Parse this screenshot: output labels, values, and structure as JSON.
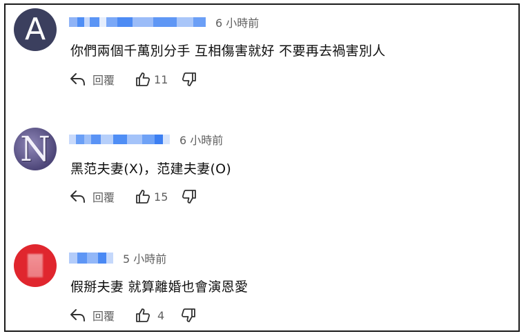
{
  "comments": [
    {
      "avatar_letter": "A",
      "time": "6 小時前",
      "text": "你們兩個千萬別分手 互相傷害就好 不要再去禍害別人",
      "reply_label": "回覆",
      "like_count": "11"
    },
    {
      "avatar_letter": "N",
      "time": "6 小時前",
      "text": "黑范夫妻(X)，范建夫妻(O)",
      "reply_label": "回覆",
      "like_count": "15"
    },
    {
      "avatar_letter": "",
      "time": "5 小時前",
      "text": "假掰夫妻 就算離婚也會演恩愛",
      "reply_label": "回覆",
      "like_count": "4"
    }
  ],
  "icons": {
    "reply": "reply-arrow-icon",
    "like": "thumbs-up-icon",
    "dislike": "thumbs-down-icon"
  },
  "colors": {
    "avatar_1": "#3b3f5e",
    "avatar_2": "#6a6199",
    "avatar_3": "#e0262e",
    "blurred_username": "#3b82f6",
    "meta_text": "#606060"
  }
}
